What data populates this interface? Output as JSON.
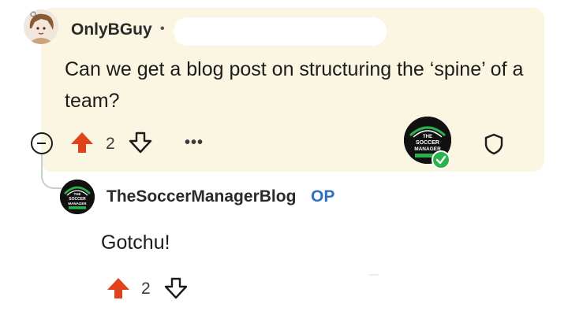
{
  "parent_comment": {
    "username": "OnlyBGuy",
    "separator": "•",
    "text": "Can we get a blog post on structuring the ‘spine’ of a team?",
    "upvote_count": "2",
    "more_label": "•••",
    "avatar_icon": "user-avatar",
    "badge_icon": "soccer-manager-badge",
    "badge_text": [
      "THE",
      "SOCCER",
      "MANAGER"
    ]
  },
  "reply_comment": {
    "username": "TheSoccerManagerBlog",
    "op_label": "OP",
    "text": "Gotchu!",
    "upvote_count": "2",
    "avatar_icon": "soccer-manager-avatar",
    "avatar_text": [
      "THE",
      "SOCCER",
      "MANAGER"
    ]
  },
  "colors": {
    "highlight_bg": "#fbf6e2",
    "upvote_active": "#e0421b",
    "op_blue": "#2f6fbf",
    "verified_green": "#2bb24c"
  }
}
